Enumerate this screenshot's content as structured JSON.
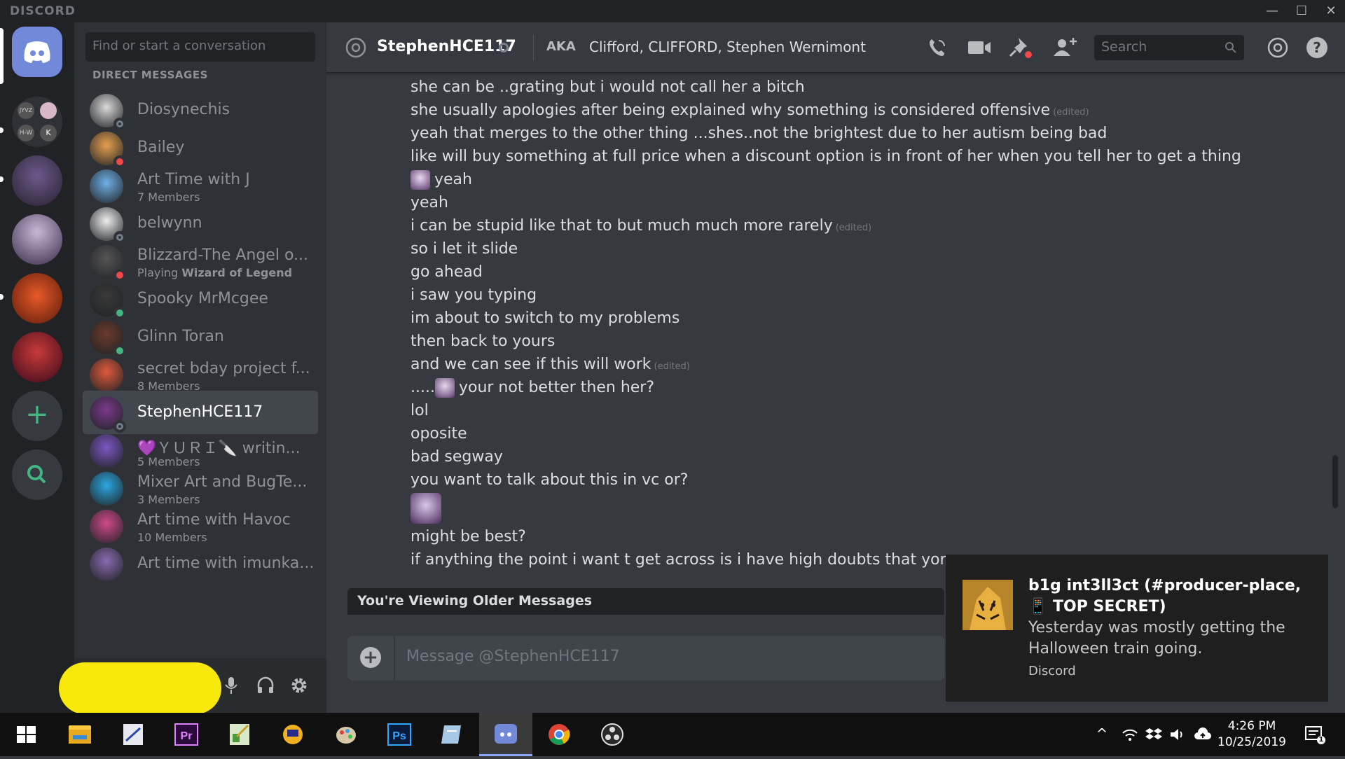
{
  "app": {
    "brand": "DISCORD"
  },
  "dm_search_placeholder": "Find or start a conversation",
  "dm_section_label": "DIRECT MESSAGES",
  "dms": [
    {
      "name": "Diosynechis",
      "sub": "",
      "status": "offline",
      "avatar_color": "#d9d9d9",
      "active": false
    },
    {
      "name": "Bailey",
      "sub": "",
      "status": "dnd",
      "avatar_color": "#e6a050",
      "active": false
    },
    {
      "name": "Art Time with J",
      "sub": "7 Members",
      "status": "",
      "avatar_color": "#6fb0e6",
      "active": false
    },
    {
      "name": "belwynn",
      "sub": "",
      "status": "offline",
      "avatar_color": "#eeeeee",
      "active": false
    },
    {
      "name": "Blizzard-The Angel o...",
      "sub": "Playing ",
      "sub_bold": "Wizard of Legend",
      "status": "dnd",
      "avatar_color": "#555555",
      "active": false
    },
    {
      "name": "Spooky MrMcgee",
      "sub": "",
      "status": "mobile",
      "avatar_color": "#3a3a3a",
      "active": false
    },
    {
      "name": "Glinn Toran",
      "sub": "",
      "status": "online",
      "avatar_color": "#6a3a2a",
      "active": false
    },
    {
      "name": "secret bday project f...",
      "sub": "8 Members",
      "status": "",
      "avatar_color": "#e05a3a",
      "active": false
    },
    {
      "name": "StephenHCE117",
      "sub": "",
      "status": "offline",
      "avatar_color": "#7a3a8a",
      "active": true
    },
    {
      "name": "💜ＹＵＲＩ🔪 writin...",
      "sub": "5 Members",
      "status": "",
      "avatar_color": "#7e57c2",
      "active": false
    },
    {
      "name": "Mixer Art and BugTe...",
      "sub": "3 Members",
      "status": "",
      "avatar_color": "#2aa8e0",
      "active": false
    },
    {
      "name": "Art time with Havoc",
      "sub": "10 Members",
      "status": "",
      "avatar_color": "#d04a8a",
      "active": false
    },
    {
      "name": "Art time with imunka...",
      "sub": "",
      "status": "",
      "avatar_color": "#8a6ab0",
      "active": false
    }
  ],
  "header": {
    "username": "StephenHCE117",
    "aka_label": "AKA",
    "aka_names": "Clifford, CLIFFORD, Stephen Wernimont",
    "search_placeholder": "Search"
  },
  "messages": [
    {
      "text": "she can be ..grating but i would not call her a bitch",
      "edited": ""
    },
    {
      "text": "she usually apologies after being explained why something is considered offensive",
      "edited": "(edited)"
    },
    {
      "text": "yeah that merges to the other thing ...shes..not the brightest due to her autism being bad",
      "edited": ""
    },
    {
      "text": "like will buy something at full price when a discount option is in front of her when you tell her to get a thing",
      "edited": ""
    },
    {
      "text": "yeah",
      "edited": "",
      "emoji": true
    },
    {
      "text": "yeah",
      "edited": ""
    },
    {
      "text": "i can be stupid like that to but much much more rarely",
      "edited": "(edited)"
    },
    {
      "text": "so i let it slide",
      "edited": ""
    },
    {
      "text": "go ahead",
      "edited": ""
    },
    {
      "text": "i saw you typing",
      "edited": ""
    },
    {
      "text": "im about to switch to my problems",
      "edited": ""
    },
    {
      "text": "then back to yours",
      "edited": ""
    },
    {
      "text": "and we can see if this will work",
      "edited": "(edited)"
    },
    {
      "text": "your not better then her?",
      "edited": "",
      "prefix": ".....",
      "emoji": true
    },
    {
      "text": "lol",
      "edited": ""
    },
    {
      "text": "oposite",
      "edited": ""
    },
    {
      "text": "bad segway",
      "edited": ""
    },
    {
      "text": "you want to talk about this in vc or?",
      "edited": ""
    },
    {
      "text": "",
      "edited": "",
      "big_emoji": true
    },
    {
      "text": "might be best?",
      "edited": ""
    },
    {
      "text": "if anything the point i want t get across is i have high doubts that yor more ...c",
      "edited": ""
    }
  ],
  "older_banner": "You're Viewing Older Messages",
  "composer_placeholder": "Message @StephenHCE117",
  "notification": {
    "title": "b1g int3ll3ct (#producer-place, 📱 TOP SECRET)",
    "body": "Yesterday was mostly getting the Halloween train going.",
    "app": "Discord"
  },
  "clock": {
    "time": "4:26 PM",
    "date": "10/25/2019"
  },
  "notification_count": "1",
  "colors": {
    "blurple": "#7289da",
    "online": "#43b581",
    "dnd": "#f04747",
    "offline": "#747f8d"
  }
}
